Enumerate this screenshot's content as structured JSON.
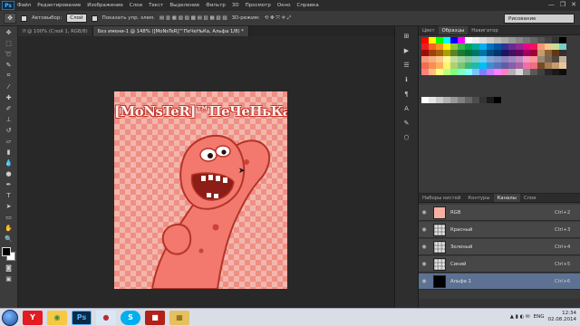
{
  "menubar": {
    "logo": "Ps",
    "items": [
      "Файл",
      "Редактирование",
      "Изображение",
      "Слои",
      "Текст",
      "Выделение",
      "Фильтр",
      "3D",
      "Просмотр",
      "Окно",
      "Справка"
    ],
    "window_controls": [
      "—",
      "❐",
      "✕"
    ]
  },
  "options": {
    "auto_select_label": "Автовыбор:",
    "auto_select_value": "Слой",
    "show_controls_label": "Показать упр. элем.",
    "mode_3d_label": "3D-режим:",
    "workspace": "Рисование"
  },
  "tabs": [
    {
      "label": "lf @ 100% (Слой 1, RGB/8)",
      "active": false
    },
    {
      "label": "Без имени-1 @ 148% ([MoNsTeR]™ПеЧеНьКа, Альфа 1/8) *",
      "active": true
    }
  ],
  "artwork": {
    "title_text": "[MoNsTeR]™ПеЧеНьКа",
    "colors": {
      "body": "#f3786d",
      "outline": "#b53427",
      "mouth": "#8c1d17"
    }
  },
  "right_panel": {
    "tabs": [
      {
        "label": "Цвет",
        "active": false
      },
      {
        "label": "Образцы",
        "active": true
      },
      {
        "label": "Навигатор",
        "active": false
      }
    ],
    "swatches": [
      "#ff0000",
      "#ffff00",
      "#00ff00",
      "#00ffff",
      "#0000ff",
      "#ff00ff",
      "#ffffff",
      "#eeeeee",
      "#dddddd",
      "#cccccc",
      "#bbbbbb",
      "#aaaaaa",
      "#999999",
      "#888888",
      "#777777",
      "#666666",
      "#555555",
      "#444444",
      "#333333",
      "#000000",
      "#ed1c24",
      "#f26522",
      "#f7941d",
      "#fff200",
      "#8dc63f",
      "#39b54a",
      "#00a651",
      "#00a99d",
      "#00aeef",
      "#0072bc",
      "#0054a6",
      "#2e3192",
      "#662d91",
      "#92278f",
      "#ec008c",
      "#ed145b",
      "#f69679",
      "#fdc689",
      "#c4df9b",
      "#7accc8",
      "#9e0b0f",
      "#a0410d",
      "#a36209",
      "#aba000",
      "#598527",
      "#1a7b30",
      "#007236",
      "#00746b",
      "#0076a3",
      "#004a80",
      "#003471",
      "#1b1464",
      "#440e62",
      "#630460",
      "#9e005d",
      "#9e0039",
      "#c69c6d",
      "#8c6239",
      "#603913",
      "#362f2d",
      "#f7977a",
      "#f9ad81",
      "#fdc68a",
      "#fff79a",
      "#c4df9b",
      "#a3d39c",
      "#82ca9d",
      "#7bcdc8",
      "#6ecff6",
      "#7ea7d8",
      "#8493ca",
      "#8882be",
      "#a187be",
      "#bc8dbf",
      "#f49ac2",
      "#f6989d",
      "#998675",
      "#736357",
      "#534741",
      "#c7b299",
      "#f26c4f",
      "#f68e55",
      "#fbaf5c",
      "#fff467",
      "#acd372",
      "#7cc576",
      "#3bb878",
      "#1abbb4",
      "#00bff3",
      "#438ccb",
      "#5574b9",
      "#605ca8",
      "#855fa8",
      "#a763a8",
      "#f06ea9",
      "#f26d7d",
      "#754c24",
      "#a67c52",
      "#c69c6d",
      "#e6c79c",
      "#ff7f7f",
      "#ffbf7f",
      "#ffff7f",
      "#bfff7f",
      "#7fff7f",
      "#7fffbf",
      "#7fffff",
      "#7fbfff",
      "#7f7fff",
      "#bf7fff",
      "#ff7fff",
      "#ff7fbf",
      "#b2b2b2",
      "#d9d9d9",
      "#8c8c8c",
      "#595959",
      "#404040",
      "#262626",
      "#1a1a1a",
      "#0d0d0d"
    ],
    "grays": [
      "#ffffff",
      "#e6e6e6",
      "#cccccc",
      "#b3b3b3",
      "#999999",
      "#808080",
      "#666666",
      "#4d4d4d",
      "#333333",
      "#1a1a1a",
      "#000000"
    ]
  },
  "layers_panel": {
    "tabs": [
      {
        "label": "Наборы кистей",
        "active": false
      },
      {
        "label": "Контуры",
        "active": false
      },
      {
        "label": "Каналы",
        "active": true
      },
      {
        "label": "Слои",
        "active": false
      }
    ],
    "channels": [
      {
        "name": "RGB",
        "shortcut": "Ctrl+2",
        "thumb": "color",
        "selected": false
      },
      {
        "name": "Красный",
        "shortcut": "Ctrl+3",
        "thumb": "gray",
        "selected": false
      },
      {
        "name": "Зеленый",
        "shortcut": "Ctrl+4",
        "thumb": "gray",
        "selected": false
      },
      {
        "name": "Синий",
        "shortcut": "Ctrl+5",
        "thumb": "gray",
        "selected": false
      },
      {
        "name": "Альфа 1",
        "shortcut": "Ctrl+6",
        "thumb": "black",
        "selected": true
      }
    ]
  },
  "taskbar": {
    "apps": [
      {
        "name": "yandex-browser",
        "glyph": "Y",
        "bg": "#e31b23",
        "fg": "#ffffff"
      },
      {
        "name": "chrome",
        "glyph": "◉",
        "bg": "#f7c844",
        "fg": "#2d8f3a"
      },
      {
        "name": "photoshop",
        "glyph": "Ps",
        "bg": "#0b2a44",
        "fg": "#4fb2ff"
      },
      {
        "name": "bandicam",
        "glyph": "●",
        "bg": "#d9e7f5",
        "fg": "#c2272d"
      },
      {
        "name": "skype",
        "glyph": "S",
        "bg": "#00aff0",
        "fg": "#ffffff"
      },
      {
        "name": "recorder",
        "glyph": "■",
        "bg": "#b32017",
        "fg": "#ffffff"
      },
      {
        "name": "files",
        "glyph": "▦",
        "bg": "#e5c05c",
        "fg": "#7a5a12"
      }
    ],
    "lang": "ENG",
    "time": "12:34",
    "date": "02.08.2014"
  }
}
